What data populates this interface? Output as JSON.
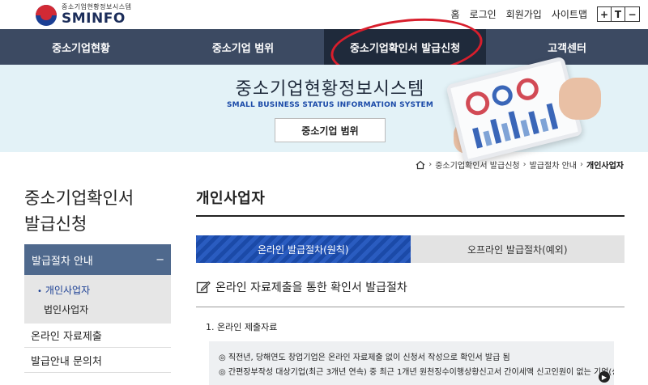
{
  "header": {
    "logo_sub": "중소기업현황정보시스템",
    "logo_main": "SMINFO",
    "util_links": [
      "홈",
      "로그인",
      "회원가입",
      "사이트맵"
    ],
    "font_controls": [
      "+",
      "T",
      "−"
    ]
  },
  "nav": {
    "items": [
      "중소기업현황",
      "중소기업 범위",
      "중소기업확인서 발급신청",
      "고객센터"
    ],
    "active_index": 2
  },
  "banner": {
    "title": "중소기업현황정보시스템",
    "subtitle": "SMALL BUSINESS STATUS INFORMATION SYSTEM",
    "button": "중소기업 범위"
  },
  "breadcrumb": {
    "items": [
      "중소기업확인서 발급신청",
      "발급절차 안내",
      "개인사업자"
    ]
  },
  "sidebar": {
    "title_line1": "중소기업확인서",
    "title_line2": "발급신청",
    "active_item": "발급절차 안내",
    "active_toggle": "−",
    "sub_items": [
      "개인사업자",
      "법인사업자"
    ],
    "items": [
      "온라인 자료제출",
      "발급안내 문의처"
    ]
  },
  "main": {
    "title": "개인사업자",
    "tabs": [
      "온라인 발급절차(원칙)",
      "오프라인 발급절차(예외)"
    ],
    "section_heading": "온라인 자료제출을 통한 확인서 발급절차",
    "list_heading": "1. 온라인 제출자료",
    "notices": [
      "◎ 직전년, 당해연도 창업기업은 온라인 자료제출 없이 신청서 작성으로 확인서 발급 됨",
      "◎ 간편장부작성 대상기업(최근 3개년 연속) 중 최근 1개년 원천징수이행상황신고서 간이세액 신고인원이 없는 기업(상"
    ]
  },
  "colors": {
    "nav_bg": "#3c4a62",
    "nav_active": "#1f2a3b",
    "banner_bg": "#e3f2f7",
    "side_active": "#4f698d",
    "tab_active": "#1b4aa8",
    "highlight_ring": "#d81e2c"
  }
}
